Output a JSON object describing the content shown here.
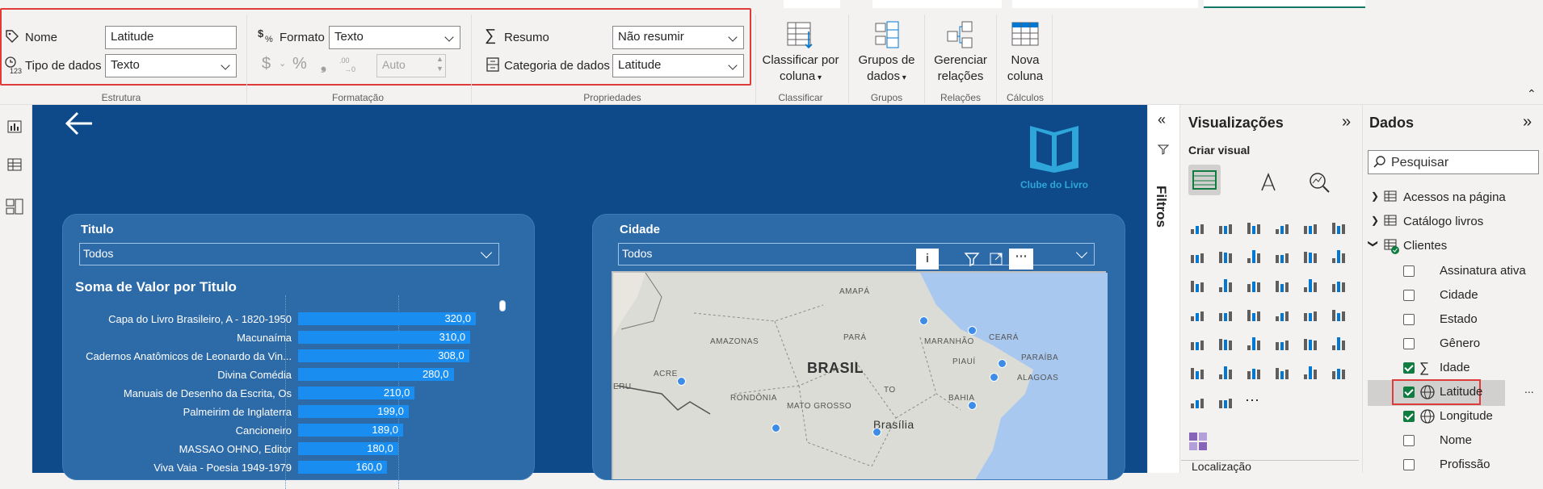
{
  "ribbon": {
    "estrutura": {
      "name_label": "Nome",
      "name_value": "Latitude",
      "type_label": "Tipo de dados",
      "type_value": "Texto",
      "group": "Estrutura"
    },
    "formatacao": {
      "format_label": "Formato",
      "format_value": "Texto",
      "currency": "$",
      "percent": "%",
      "comma": "9",
      "decimal_placeholder": "Auto",
      "group": "Formatação"
    },
    "propriedades": {
      "summary_label": "Resumo",
      "summary_value": "Não resumir",
      "category_label": "Categoria de dados",
      "category_value": "Latitude",
      "group": "Propriedades"
    },
    "classificar": {
      "btn_line1": "Classificar por",
      "btn_line2": "coluna",
      "group": "Classificar"
    },
    "grupos": {
      "btn_line1": "Grupos de",
      "btn_line2": "dados",
      "group": "Grupos"
    },
    "relacoes": {
      "btn_line1": "Gerenciar",
      "btn_line2": "relações",
      "group": "Relações"
    },
    "calculos": {
      "btn_line1": "Nova",
      "btn_line2": "coluna",
      "group": "Cálculos"
    }
  },
  "report": {
    "logo_text": "Clube do Livro",
    "titulo_slicer": {
      "title": "Titulo",
      "value": "Todos"
    },
    "cidade_slicer": {
      "title": "Cidade",
      "value": "Todos"
    },
    "bar_chart_title": "Soma de Valor por Titulo",
    "map": {
      "labels": [
        "AMAPÁ",
        "AMAZONAS",
        "PARÁ",
        "MARANHÃO",
        "CEARÁ",
        "PARAÍBA",
        "PIAUÍ",
        "ALAGOAS",
        "ACRE",
        "RONDÔNIA",
        "TO",
        "BAHIA",
        "MATO GROSSO",
        "Brasília",
        "BRASIL",
        "ERU"
      ]
    }
  },
  "chart_data": {
    "type": "bar",
    "orientation": "horizontal",
    "title": "Soma de Valor por Titulo",
    "categories": [
      "Capa do Livro Brasileiro, A - 1820-1950",
      "Macunaíma",
      "Cadernos Anatômicos de Leonardo da Vin...",
      "Divina Comédia",
      "Manuais de Desenho da Escrita, Os",
      "Palmeirim de Inglaterra",
      "Cancioneiro",
      "MASSAO OHNO, Editor",
      "Viva Vaia - Poesia 1949-1979"
    ],
    "values": [
      320.0,
      310.0,
      308.0,
      280.0,
      210.0,
      199.0,
      189.0,
      180.0,
      160.0
    ],
    "value_labels": [
      "320,0",
      "310,0",
      "308,0",
      "280,0",
      "210,0",
      "199,0",
      "189,0",
      "180,0",
      "160,0"
    ],
    "xlim": [
      0,
      400
    ],
    "color": "#1a8ef0"
  },
  "filters": {
    "label": "Filtros"
  },
  "visualizations": {
    "title": "Visualizações",
    "subtitle": "Criar visual",
    "section": "Localização"
  },
  "data_pane": {
    "title": "Dados",
    "search_placeholder": "Pesquisar",
    "tables": [
      {
        "name": "Acessos na página"
      },
      {
        "name": "Catálogo livros"
      },
      {
        "name": "Clientes"
      }
    ],
    "fields": [
      {
        "name": "Assinatura ativa",
        "checked": false,
        "icon": "none"
      },
      {
        "name": "Cidade",
        "checked": false,
        "icon": "none"
      },
      {
        "name": "Estado",
        "checked": false,
        "icon": "none"
      },
      {
        "name": "Gênero",
        "checked": false,
        "icon": "none"
      },
      {
        "name": "Idade",
        "checked": true,
        "icon": "sigma-icon"
      },
      {
        "name": "Latitude",
        "checked": true,
        "icon": "globe-icon"
      },
      {
        "name": "Longitude",
        "checked": true,
        "icon": "globe-icon"
      },
      {
        "name": "Nome",
        "checked": false,
        "icon": "none"
      },
      {
        "name": "Profissão",
        "checked": false,
        "icon": "none"
      }
    ],
    "more": "..."
  },
  "colors": {
    "report_bg": "#0e4a8a",
    "card_bg": "#2d6aa8",
    "bar": "#1a8ef0",
    "highlight": "#e03b3b",
    "check": "#107c41"
  }
}
